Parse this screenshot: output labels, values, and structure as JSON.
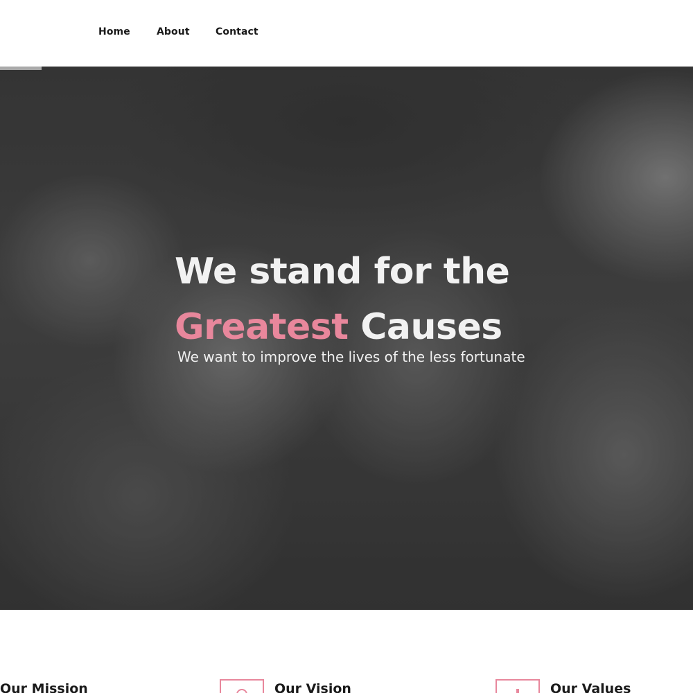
{
  "nav": {
    "items": [
      {
        "label": "Home"
      },
      {
        "label": "About"
      },
      {
        "label": "Contact"
      }
    ]
  },
  "hero": {
    "headline_line1": "We stand for the",
    "headline_accent": "Greatest",
    "headline_rest": "Causes",
    "subtitle": "We want to improve the lives of the less fortunate"
  },
  "features": [
    {
      "title": "Our Mission",
      "icon": "mission-icon"
    },
    {
      "title": "Our Vision",
      "icon": "vision-icon"
    },
    {
      "title": "Our Values",
      "icon": "values-icon"
    }
  ],
  "colors": {
    "accent": "#e8879c",
    "text_dark": "#1a1a1a",
    "hero_text": "#f2f2f2"
  }
}
